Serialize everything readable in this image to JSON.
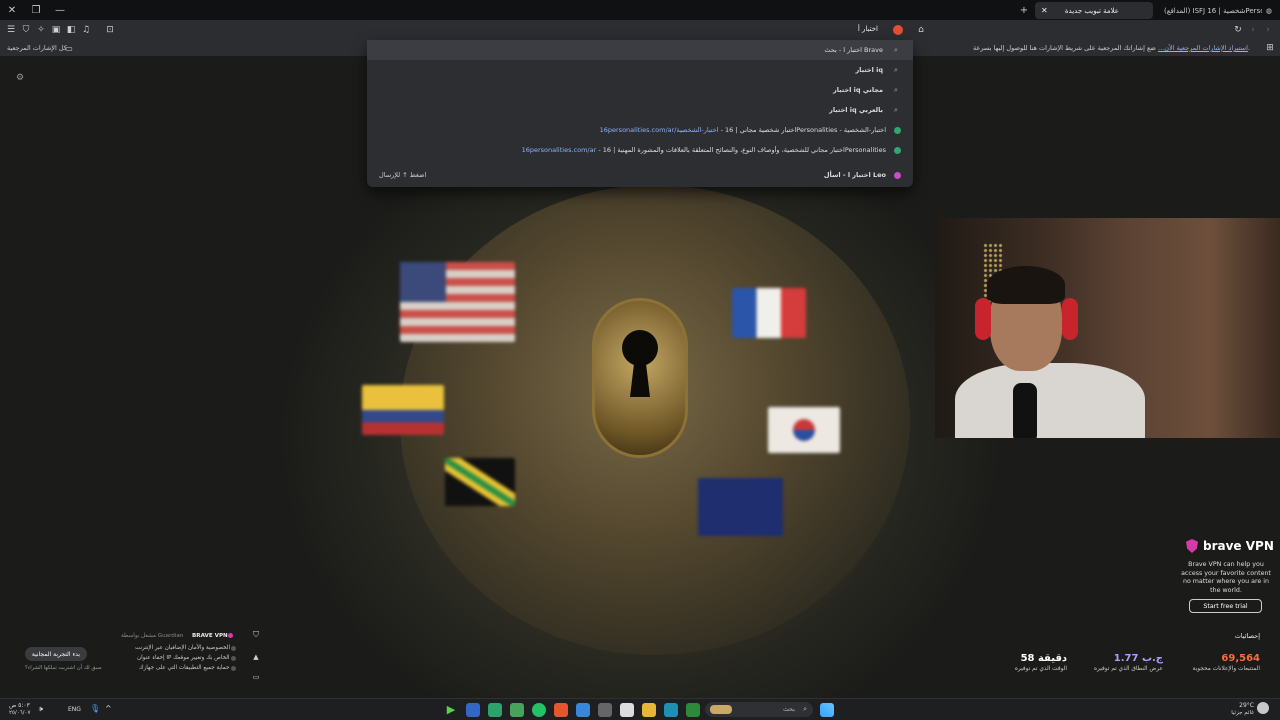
{
  "tabs": [
    {
      "label": "(المدافع) ISFJ شخصية | 16Personalities"
    },
    {
      "label": "علامة تبويب جديدة"
    }
  ],
  "toolbar": {
    "url_text": "اختبار أ"
  },
  "bookmarks": {
    "all_bookmarks": "كل الإشارات المرجعية",
    "hint": "ضع إشاراتك المرجعية على شريط الإشارات هنا للوصول إليها بسرعة.",
    "import_link": "استيراد الإشارات المرجعية الآن..."
  },
  "omnibox": {
    "suggestions": [
      {
        "text": "اختبار ا - بحث Brave",
        "url": "",
        "kind": "search"
      },
      {
        "text": "اختبار iq",
        "url": "",
        "kind": "search"
      },
      {
        "text": "اختبار iq مجاني",
        "url": "",
        "kind": "search"
      },
      {
        "text": "اختبار iq بالعربي",
        "url": "",
        "kind": "search"
      },
      {
        "text": "اختبار شخصية مجاني | 16Personalities - اختبار-الشخصية",
        "url": "16personalities.com/ar/اختبار-الشخصية",
        "kind": "site"
      },
      {
        "text": "اختبار مجاني للشخصية، وأوصاف النوع، والنصائح المتعلقة بالعلاقات والمشورة المهنية | 16Personalities",
        "url": "16personalities.com/ar",
        "kind": "site"
      },
      {
        "text": "اختبار ا - اسأل Leo",
        "url": "",
        "kind": "leo"
      }
    ],
    "hint": "اضغط ↑ للإرسال"
  },
  "vpn": {
    "title": "brave VPN",
    "description": "Brave VPN can help you access your favorite content no matter where you are in the world.",
    "button": "Start free trial"
  },
  "stats": {
    "title": "إحصائيات",
    "items": [
      {
        "value": "69,564",
        "label": "المتتبعات والإعلانات محجوبة",
        "color": "#ff6a3d"
      },
      {
        "value": "1.77 ج.ب",
        "label": "عرض النطاق الذي تم توفيره",
        "color": "#b29cff"
      },
      {
        "value": "58 دقيقة",
        "label": "الوقت الذي تم توفيره",
        "color": "#ffffff"
      }
    ]
  },
  "vpn_widget": {
    "title": "BRAVE VPN",
    "powered": "مشغل بواسطة Guardian",
    "bullets": [
      "الخصوصية والأمان الإضافيان عبر الإنترنت",
      "إخفاء عنوان IP الخاص بك وتغيير موقعك",
      "حماية جميع التطبيقات التي على جهازك"
    ],
    "trial_button": "بدء التجربة المجانية",
    "footer": "سبق لك أن اشتريت تملكها الشراء؟"
  },
  "taskbar": {
    "search_placeholder": "بحث",
    "language": "ENG",
    "time": "٥:٠٣ ص",
    "date": "٢٥/٠٦/٠٧",
    "weather_temp": "29°C",
    "weather_desc": "غائم جزئيا"
  }
}
